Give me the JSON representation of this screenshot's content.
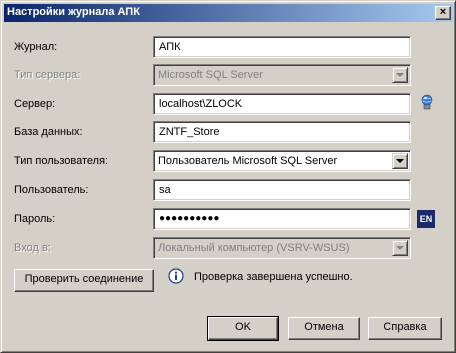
{
  "window": {
    "title": "Настройки журнала АПК",
    "close_glyph": "×"
  },
  "form": {
    "journal": {
      "label": "Журнал:",
      "value": "АПК"
    },
    "server_type": {
      "label": "Тип сервера:",
      "value": "Microsoft SQL Server",
      "disabled": true
    },
    "server": {
      "label": "Сервер:",
      "value": "localhost\\ZLOCK"
    },
    "database": {
      "label": "База данных:",
      "value": "ZNTF_Store"
    },
    "user_type": {
      "label": "Тип пользователя:",
      "value": "Пользователь Microsoft SQL Server"
    },
    "user": {
      "label": "Пользователь:",
      "value": "sa"
    },
    "password": {
      "label": "Пароль:",
      "value": "●●●●●●●●●●",
      "lang_badge": "EN"
    },
    "login_to": {
      "label": "Вход в:",
      "value": "Локальный компьютер (VSRV-WSUS)",
      "disabled": true
    }
  },
  "test": {
    "button_label": "Проверить соединение",
    "status_text": "Проверка завершена успешно."
  },
  "footer": {
    "ok_label": "OK",
    "cancel_label": "Отмена",
    "help_label": "Справка"
  },
  "icons": {
    "server_browse": "server-globe-icon",
    "info": "info-icon"
  },
  "colors": {
    "title_start": "#0a246a",
    "title_end": "#a6caf0",
    "face": "#d4d0c8",
    "lang_badge": "#1a2a6c"
  }
}
